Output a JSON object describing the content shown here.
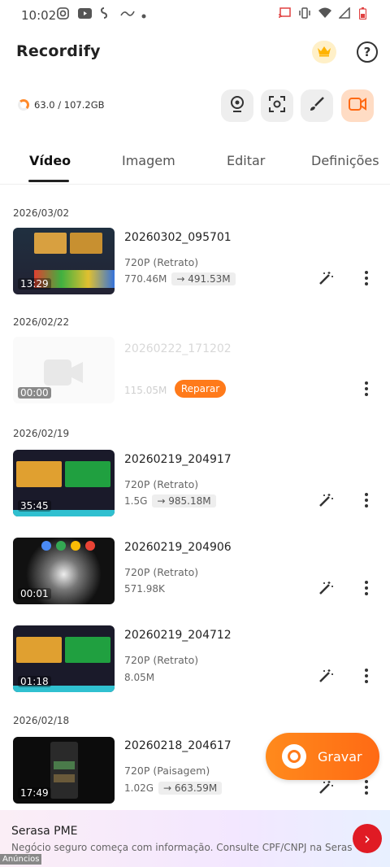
{
  "status_bar": {
    "time": "10:02"
  },
  "app": {
    "title": "Recordify"
  },
  "storage": {
    "text": "63.0 / 107.2GB"
  },
  "tabs": [
    {
      "label": "Vídeo"
    },
    {
      "label": "Imagem"
    },
    {
      "label": "Editar"
    },
    {
      "label": "Definições"
    }
  ],
  "groups": [
    {
      "date": "2026/03/02"
    },
    {
      "date": "2026/02/22"
    },
    {
      "date": "2026/02/19"
    },
    {
      "date": "2026/02/18"
    }
  ],
  "videos": [
    {
      "name": "20260302_095701",
      "resolution": "720P (Retrato)",
      "size": "770.46M",
      "compressed": "491.53M",
      "duration": "13:29"
    },
    {
      "name": "20260222_171202",
      "size": "115.05M",
      "duration": "00:00",
      "repair_label": "Reparar"
    },
    {
      "name": "20260219_204917",
      "resolution": "720P (Retrato)",
      "size": "1.5G",
      "compressed": "985.18M",
      "duration": "35:45"
    },
    {
      "name": "20260219_204906",
      "resolution": "720P (Retrato)",
      "size": "571.98K",
      "duration": "00:01"
    },
    {
      "name": "20260219_204712",
      "resolution": "720P (Retrato)",
      "size": "8.05M",
      "duration": "01:18"
    },
    {
      "name": "20260218_204617",
      "resolution": "720P (Paisagem)",
      "size": "1.02G",
      "compressed": "663.59M",
      "duration": "17:49"
    }
  ],
  "record_button": {
    "label": "Gravar"
  },
  "ad": {
    "title": "Serasa PME",
    "text": "Negócio seguro começa com informação. Consulte CPF/CNPJ na Serasa E...",
    "label": "Anúncios"
  },
  "colors": {
    "accent": "#ff7a1a",
    "repair": "#ff7a1a",
    "ad_button": "#e01b24"
  }
}
